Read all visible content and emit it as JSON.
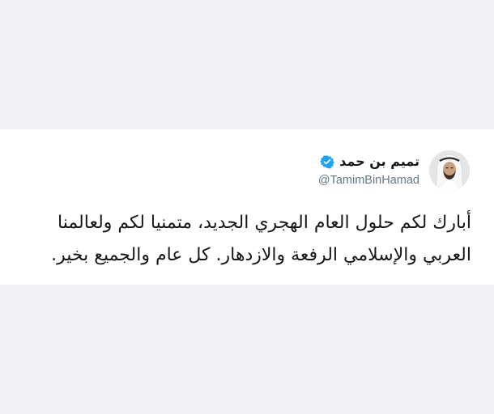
{
  "tweet": {
    "author": {
      "display_name": "تميم بن حمد",
      "handle": "@TamimBinHamad",
      "verified_icon": "verified-badge-icon",
      "avatar_icon": "profile-avatar"
    },
    "text_lines": [
      "أبارك لكم حلول العام الهجري الجديد، متمنيا لكم ولعالمنا",
      "العربي والإسلامي الرفعة والازدهار. كل عام والجميع بخير."
    ]
  },
  "colors": {
    "verified_blue": "#1da1f2",
    "text": "#14171a",
    "handle": "#657786",
    "background": "#f1f1f3",
    "card": "#ffffff"
  }
}
